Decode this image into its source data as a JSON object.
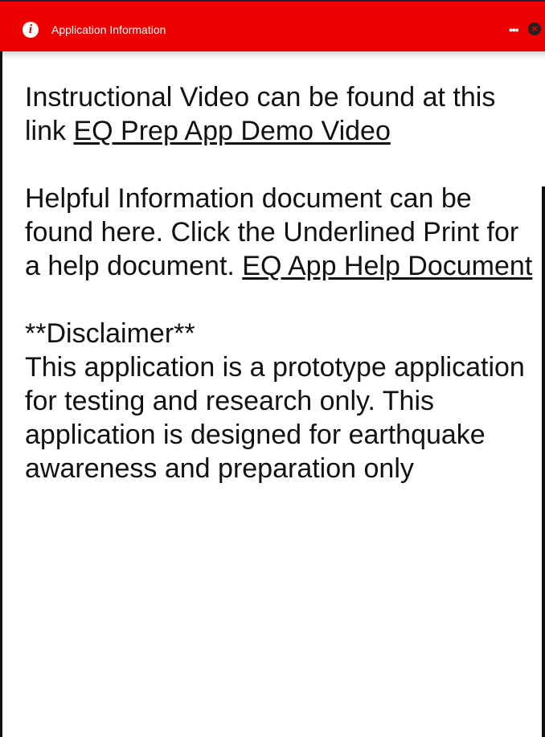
{
  "window": {
    "title": "Application Information",
    "info_icon_glyph": "i",
    "more_glyph": "•••",
    "close_glyph": "×",
    "accent_color": "#ee0000"
  },
  "content": {
    "video_text": "Instructional Video can be found at this link ",
    "video_link": "EQ Prep App Demo Video",
    "help_text": "Helpful Information document can be found here. Click the Underlined Print for a help document. ",
    "help_link": "EQ App Help Document",
    "disclaimer_heading": "**Disclaimer**",
    "disclaimer_text": "This application is a prototype application for testing and research only. This application is designed for earthquake awareness and preparation only"
  }
}
